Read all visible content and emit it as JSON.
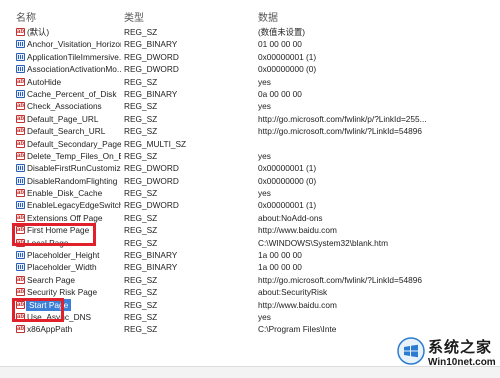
{
  "columns": {
    "name": "名称",
    "type": "类型",
    "data": "数据"
  },
  "rows": [
    {
      "icon": "sz",
      "name": "(默认)",
      "type": "REG_SZ",
      "data": "(数值未设置)"
    },
    {
      "icon": "bin",
      "name": "Anchor_Visitation_Horizon",
      "type": "REG_BINARY",
      "data": "01 00 00 00"
    },
    {
      "icon": "bin",
      "name": "ApplicationTileImmersive...",
      "type": "REG_DWORD",
      "data": "0x00000001 (1)"
    },
    {
      "icon": "bin",
      "name": "AssociationActivationMo...",
      "type": "REG_DWORD",
      "data": "0x00000000 (0)"
    },
    {
      "icon": "sz",
      "name": "AutoHide",
      "type": "REG_SZ",
      "data": "yes"
    },
    {
      "icon": "bin",
      "name": "Cache_Percent_of_Disk",
      "type": "REG_BINARY",
      "data": "0a 00 00 00"
    },
    {
      "icon": "sz",
      "name": "Check_Associations",
      "type": "REG_SZ",
      "data": "yes"
    },
    {
      "icon": "sz",
      "name": "Default_Page_URL",
      "type": "REG_SZ",
      "data": "http://go.microsoft.com/fwlink/p/?LinkId=255..."
    },
    {
      "icon": "sz",
      "name": "Default_Search_URL",
      "type": "REG_SZ",
      "data": "http://go.microsoft.com/fwlink/?LinkId=54896"
    },
    {
      "icon": "sz",
      "name": "Default_Secondary_Page_...",
      "type": "REG_MULTI_SZ",
      "data": ""
    },
    {
      "icon": "sz",
      "name": "Delete_Temp_Files_On_Exit",
      "type": "REG_SZ",
      "data": "yes"
    },
    {
      "icon": "bin",
      "name": "DisableFirstRunCustomize",
      "type": "REG_DWORD",
      "data": "0x00000001 (1)"
    },
    {
      "icon": "bin",
      "name": "DisableRandomFlighting",
      "type": "REG_DWORD",
      "data": "0x00000000 (0)"
    },
    {
      "icon": "sz",
      "name": "Enable_Disk_Cache",
      "type": "REG_SZ",
      "data": "yes"
    },
    {
      "icon": "bin",
      "name": "EnableLegacyEdgeSwitch...",
      "type": "REG_DWORD",
      "data": "0x00000001 (1)"
    },
    {
      "icon": "sz",
      "name": "Extensions Off Page",
      "type": "REG_SZ",
      "data": "about:NoAdd-ons"
    },
    {
      "icon": "sz",
      "name": "First Home Page",
      "type": "REG_SZ",
      "data": "http://www.baidu.com"
    },
    {
      "icon": "sz",
      "name": "Local Page",
      "type": "REG_SZ",
      "data": "C:\\WINDOWS\\System32\\blank.htm"
    },
    {
      "icon": "bin",
      "name": "Placeholder_Height",
      "type": "REG_BINARY",
      "data": "1a 00 00 00"
    },
    {
      "icon": "bin",
      "name": "Placeholder_Width",
      "type": "REG_BINARY",
      "data": "1a 00 00 00"
    },
    {
      "icon": "sz",
      "name": "Search Page",
      "type": "REG_SZ",
      "data": "http://go.microsoft.com/fwlink/?LinkId=54896"
    },
    {
      "icon": "sz",
      "name": "Security Risk Page",
      "type": "REG_SZ",
      "data": "about:SecurityRisk"
    },
    {
      "icon": "sz",
      "name": "Start Page",
      "type": "REG_SZ",
      "data": "http://www.baidu.com",
      "selected": true
    },
    {
      "icon": "sz",
      "name": "Use_Async_DNS",
      "type": "REG_SZ",
      "data": "yes"
    },
    {
      "icon": "sz",
      "name": "x86AppPath",
      "type": "REG_SZ",
      "data": "C:\\Program Files\\Inte"
    }
  ],
  "highlighted_rows": [
    "First Home Page",
    "Start Page"
  ],
  "watermark": {
    "title": "系统之家",
    "url": "Win10net.com"
  },
  "colors": {
    "selection": "#3c7fd6",
    "highlight_box": "#e0202a",
    "string_icon": "#c43030",
    "binary_icon": "#2c5fb8"
  }
}
